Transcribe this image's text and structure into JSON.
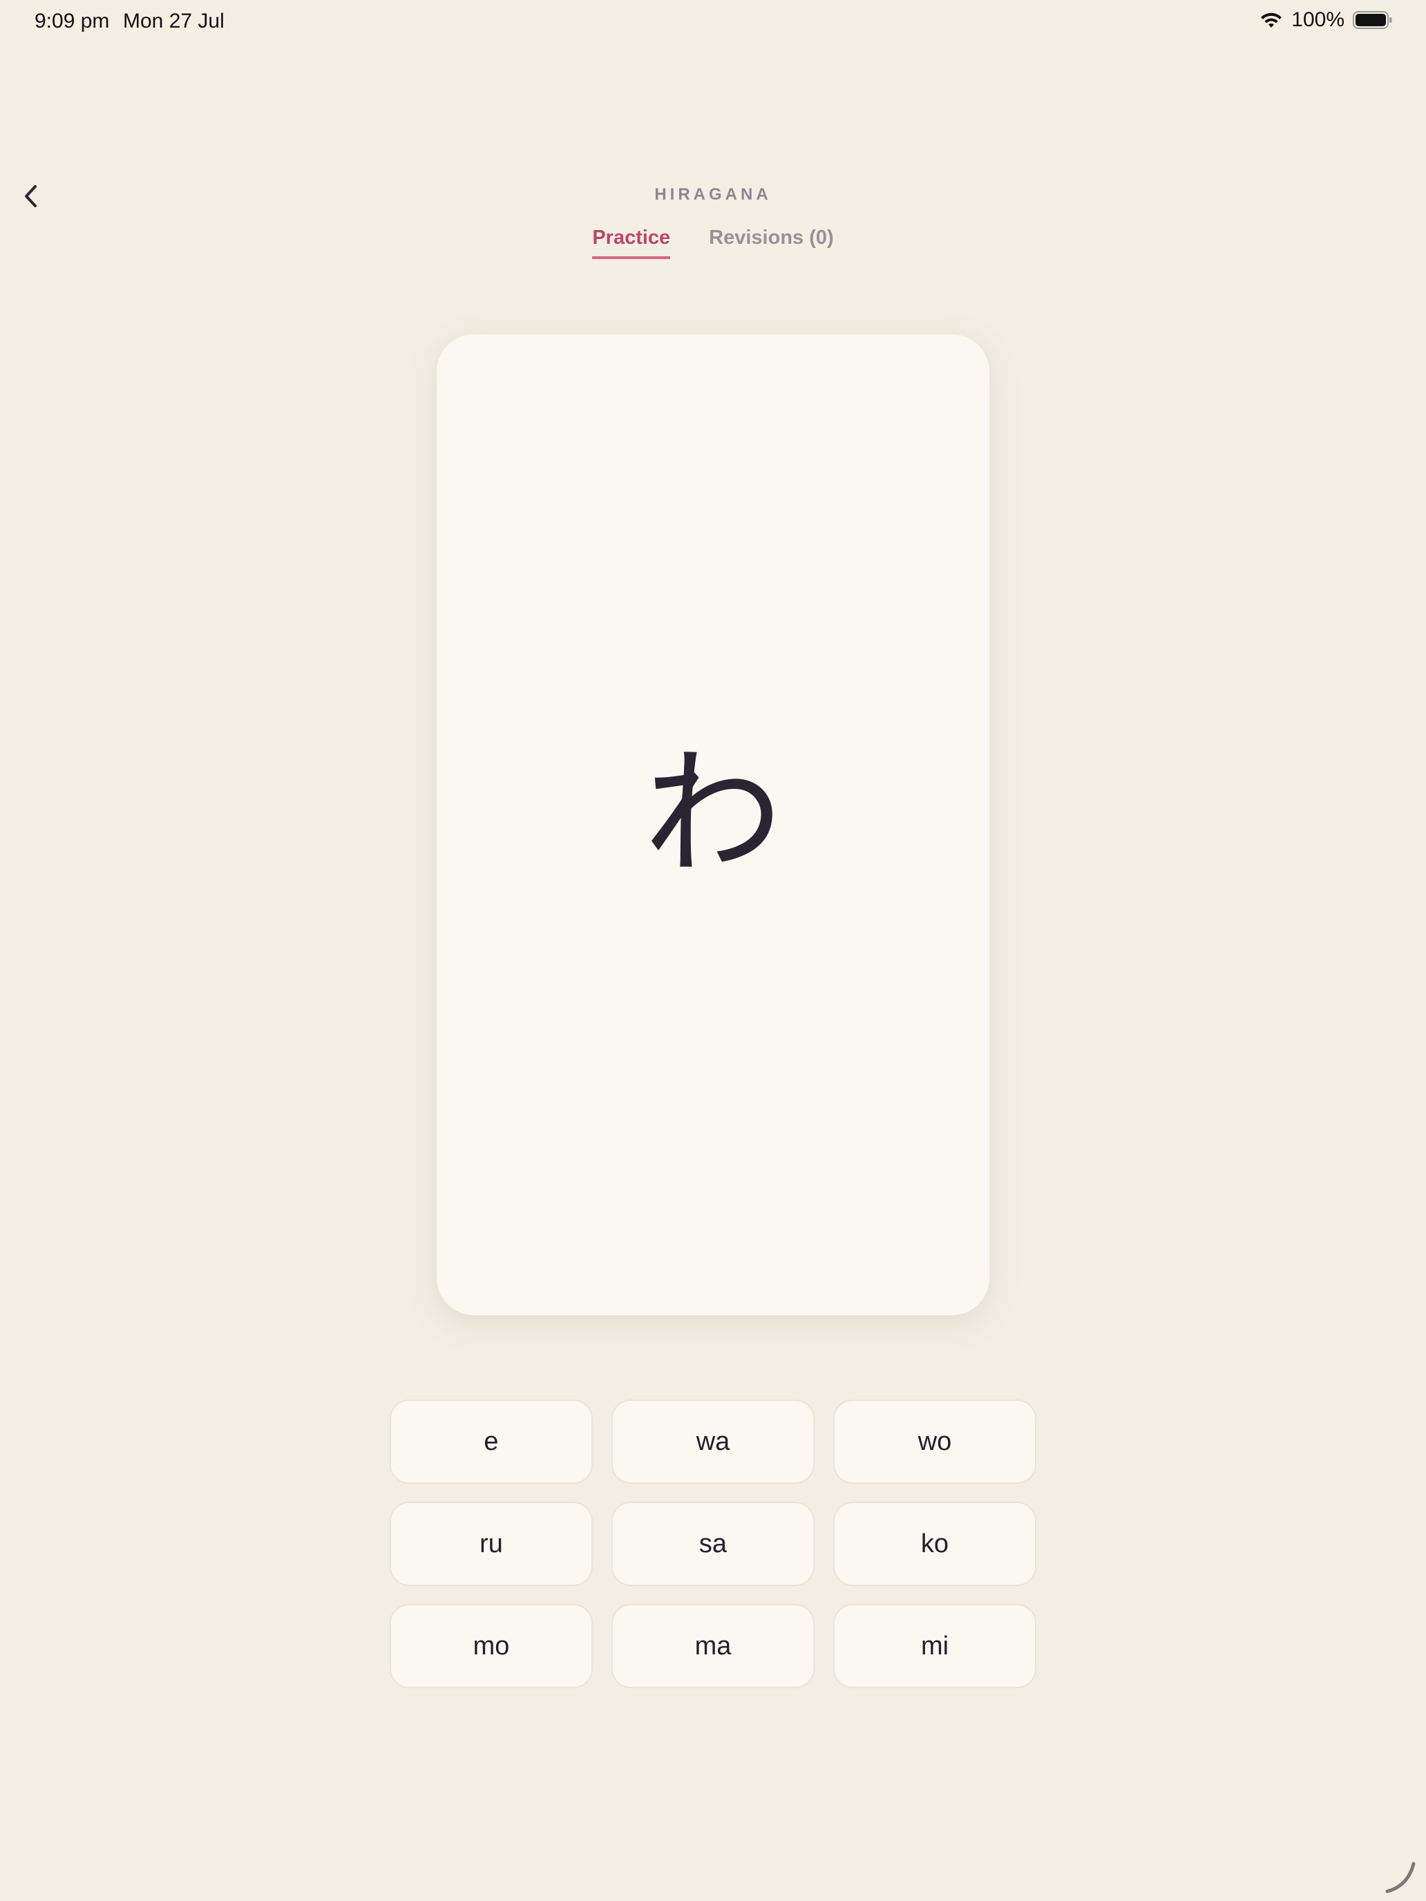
{
  "status_bar": {
    "time": "9:09 pm",
    "date": "Mon 27 Jul",
    "battery_percent": "100%",
    "icons": [
      "wifi-icon",
      "battery-icon"
    ]
  },
  "header": {
    "back_icon": "chevron-left-icon",
    "section_title": "HIRAGANA",
    "tabs": [
      {
        "label": "Practice",
        "active": true
      },
      {
        "label": "Revisions (0)",
        "active": false
      }
    ]
  },
  "card": {
    "kana": "わ"
  },
  "answers": [
    {
      "label": "e"
    },
    {
      "label": "wa"
    },
    {
      "label": "wo"
    },
    {
      "label": "ru"
    },
    {
      "label": "sa"
    },
    {
      "label": "ko"
    },
    {
      "label": "mo"
    },
    {
      "label": "ma"
    },
    {
      "label": "mi"
    }
  ],
  "colors": {
    "background": "#f4eee3",
    "card": "#fbf8f2",
    "accent": "#b8476a",
    "text": "#2a2533",
    "muted": "#9a8f9b"
  }
}
